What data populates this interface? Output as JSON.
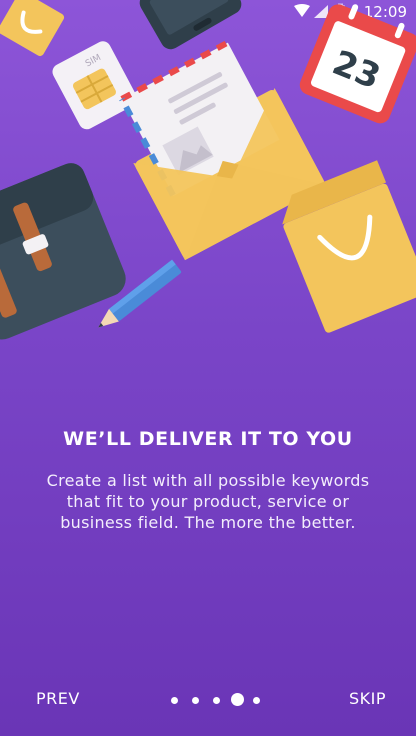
{
  "status_bar": {
    "time": "12:09",
    "icons": [
      "wifi-icon",
      "cell-signal-icon",
      "battery-icon"
    ]
  },
  "illustration": {
    "icons": [
      "sim-card-icon",
      "smartphone-icon",
      "calendar-icon",
      "envelope-icon",
      "briefcase-icon",
      "pencil-icon",
      "shopping-bag-icon",
      "sticky-note-icon"
    ],
    "calendar_date": "23",
    "sim_label": "SIM"
  },
  "onboarding": {
    "title": "WE’LL DELIVER IT TO YOU",
    "description": "Create a list with all possible keywords that fit to your product, service or business field. The more the better."
  },
  "navigation": {
    "prev_label": "PREV",
    "skip_label": "SKIP",
    "page_count": 5,
    "active_page": 4
  },
  "colors": {
    "background_top": "#8d55d8",
    "background_bottom": "#6a35b6",
    "accent_yellow": "#f3c55c",
    "accent_red": "#ea4a4a",
    "dark_slate": "#3c4e5c"
  }
}
